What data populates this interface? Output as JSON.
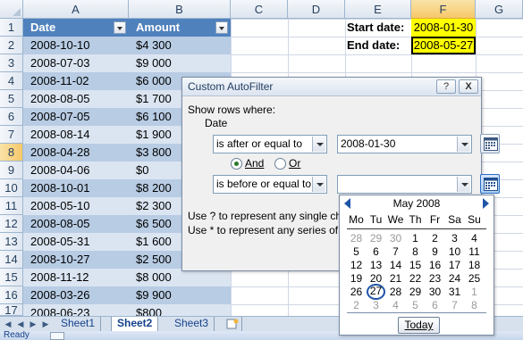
{
  "columns": [
    "A",
    "B",
    "C",
    "D",
    "E",
    "F",
    "G"
  ],
  "rows": [
    "1",
    "2",
    "3",
    "4",
    "5",
    "6",
    "7",
    "8",
    "9",
    "10",
    "11",
    "12",
    "13",
    "14",
    "15",
    "16",
    "17"
  ],
  "table": {
    "headers": [
      "Date",
      "Amount"
    ],
    "data": [
      [
        "2008-10-10",
        "$4 300"
      ],
      [
        "2008-07-03",
        "$9 000"
      ],
      [
        "2008-11-02",
        "$6 000"
      ],
      [
        "2008-08-05",
        "$1 700"
      ],
      [
        "2008-07-05",
        "$6 100"
      ],
      [
        "2008-08-14",
        "$1 900"
      ],
      [
        "2008-04-28",
        "$3 800"
      ],
      [
        "2008-04-06",
        "$0"
      ],
      [
        "2008-10-01",
        "$8 200"
      ],
      [
        "2008-05-10",
        "$2 300"
      ],
      [
        "2008-08-05",
        "$6 500"
      ],
      [
        "2008-05-31",
        "$1 600"
      ],
      [
        "2008-10-27",
        "$2 500"
      ],
      [
        "2008-11-12",
        "$8 000"
      ],
      [
        "2008-03-26",
        "$9 900"
      ],
      [
        "2008-06-23",
        "$800"
      ]
    ]
  },
  "params": {
    "start_label": "Start date:",
    "start_value": "2008-01-30",
    "end_label": "End date:",
    "end_value": "2008-05-27"
  },
  "dialog": {
    "title": "Custom AutoFilter",
    "help_btn": "?",
    "close_btn": "X",
    "show_rows": "Show rows where:",
    "field": "Date",
    "op1": "is after or equal to",
    "val1": "2008-01-30",
    "and_label": "And",
    "or_label": "Or",
    "op2": "is before or equal to",
    "val2": "",
    "hint1": "Use ? to represent any single chara",
    "hint2": "Use * to represent any series of ch"
  },
  "calendar": {
    "month_label": "May 2008",
    "weekdays": [
      "Mo",
      "Tu",
      "We",
      "Th",
      "Fr",
      "Sa",
      "Su"
    ],
    "weeks": [
      [
        {
          "d": "28",
          "dim": true
        },
        {
          "d": "29",
          "dim": true
        },
        {
          "d": "30",
          "dim": true
        },
        {
          "d": "1"
        },
        {
          "d": "2"
        },
        {
          "d": "3"
        },
        {
          "d": "4"
        }
      ],
      [
        {
          "d": "5"
        },
        {
          "d": "6"
        },
        {
          "d": "7"
        },
        {
          "d": "8"
        },
        {
          "d": "9"
        },
        {
          "d": "10"
        },
        {
          "d": "11"
        }
      ],
      [
        {
          "d": "12"
        },
        {
          "d": "13"
        },
        {
          "d": "14"
        },
        {
          "d": "15"
        },
        {
          "d": "16"
        },
        {
          "d": "17"
        },
        {
          "d": "18"
        }
      ],
      [
        {
          "d": "19"
        },
        {
          "d": "20"
        },
        {
          "d": "21"
        },
        {
          "d": "22"
        },
        {
          "d": "23"
        },
        {
          "d": "24"
        },
        {
          "d": "25"
        }
      ],
      [
        {
          "d": "26"
        },
        {
          "d": "27",
          "today": true
        },
        {
          "d": "28"
        },
        {
          "d": "29"
        },
        {
          "d": "30"
        },
        {
          "d": "31"
        },
        {
          "d": "1",
          "dim": true
        }
      ],
      [
        {
          "d": "2",
          "dim": true
        },
        {
          "d": "3",
          "dim": true
        },
        {
          "d": "4",
          "dim": true
        },
        {
          "d": "5",
          "dim": true
        },
        {
          "d": "6",
          "dim": true
        },
        {
          "d": "7",
          "dim": true
        },
        {
          "d": "8",
          "dim": true
        }
      ]
    ],
    "today_button": "Today"
  },
  "sheet_tabs": [
    "Sheet1",
    "Sheet2",
    "Sheet3"
  ],
  "active_tab": "Sheet2",
  "status": "Ready",
  "colors": {
    "table_header": "#4f81bd",
    "band_dark": "#b8cce4",
    "band_light": "#dbe5f1",
    "highlight": "#ffff00"
  }
}
